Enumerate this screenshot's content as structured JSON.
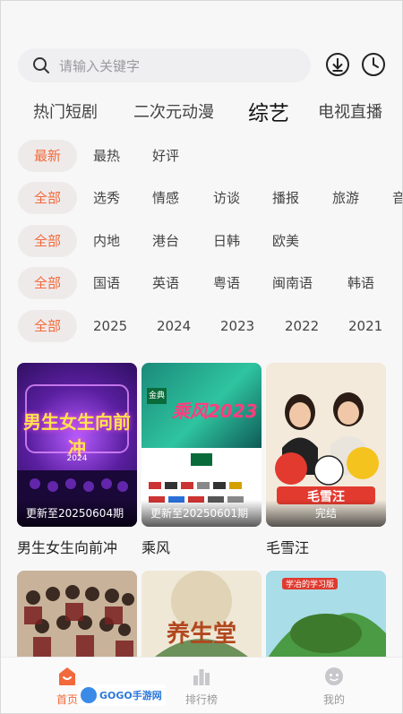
{
  "search": {
    "placeholder": "请输入关键字"
  },
  "categories": [
    {
      "label": "热门短剧"
    },
    {
      "label": "二次元动漫"
    },
    {
      "label": "综艺",
      "active": true
    },
    {
      "label": "电视直播"
    }
  ],
  "filters": {
    "sort": [
      "最新",
      "最热",
      "好评"
    ],
    "type": [
      "全部",
      "选秀",
      "情感",
      "访谈",
      "播报",
      "旅游",
      "音"
    ],
    "region": [
      "全部",
      "内地",
      "港台",
      "日韩",
      "欧美"
    ],
    "language": [
      "全部",
      "国语",
      "英语",
      "粤语",
      "闽南语",
      "韩语"
    ],
    "year": [
      "全部",
      "2025",
      "2024",
      "2023",
      "2022",
      "2021"
    ]
  },
  "cards": [
    {
      "title": "男生女生向前冲",
      "status": "更新至20250604期",
      "poster_text": "男生女生向前冲",
      "poster_year": "2024"
    },
    {
      "title": "乘风",
      "status": "更新至20250601期",
      "poster_text": "乘风2023",
      "poster_brand": "金典"
    },
    {
      "title": "毛雪汪",
      "status": "完结",
      "poster_text": "毛雪汪"
    }
  ],
  "cards_row2": [
    {
      "poster_text": ""
    },
    {
      "poster_text": "养生堂"
    },
    {
      "poster_text": "学冶的学习版"
    }
  ],
  "bottom_nav": [
    {
      "label": "首页",
      "icon": "home-icon",
      "active": true
    },
    {
      "label": "排行榜",
      "icon": "ranking-icon"
    },
    {
      "label": "我的",
      "icon": "profile-icon"
    }
  ],
  "watermark": {
    "text": "GOGO手游网"
  },
  "colors": {
    "accent": "#f26a3b",
    "background": "#f7f7f8",
    "chip_bg": "#efeaea"
  }
}
